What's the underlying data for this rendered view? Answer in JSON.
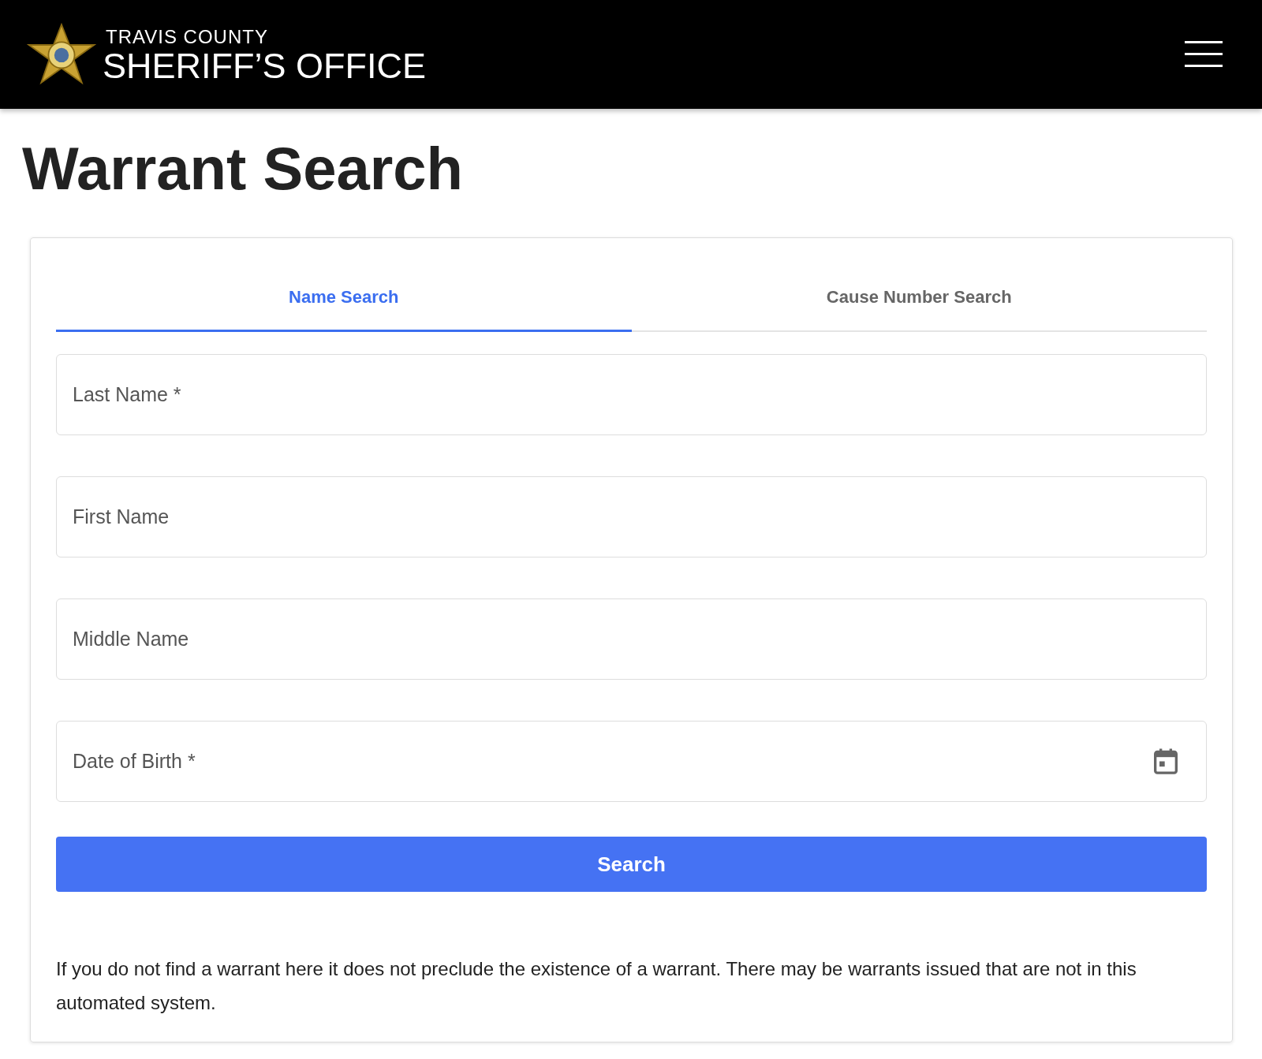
{
  "header": {
    "org_line_1": "TRAVIS COUNTY",
    "org_line_2": "SHERIFF’S OFFICE"
  },
  "page_title": "Warrant Search",
  "tabs": [
    {
      "label": "Name Search",
      "selected": true
    },
    {
      "label": "Cause Number Search",
      "selected": false
    }
  ],
  "fields": [
    {
      "kind": "text",
      "placeholder": "Last Name *"
    },
    {
      "kind": "text",
      "placeholder": "First Name"
    },
    {
      "kind": "text",
      "placeholder": "Middle Name"
    },
    {
      "kind": "date",
      "placeholder": "Date of Birth *"
    }
  ],
  "submit_button": "Search",
  "disclaimer": "If you do not find a warrant here it does not preclude the existence of a warrant. There may be warrants issued that are not in this automated system."
}
